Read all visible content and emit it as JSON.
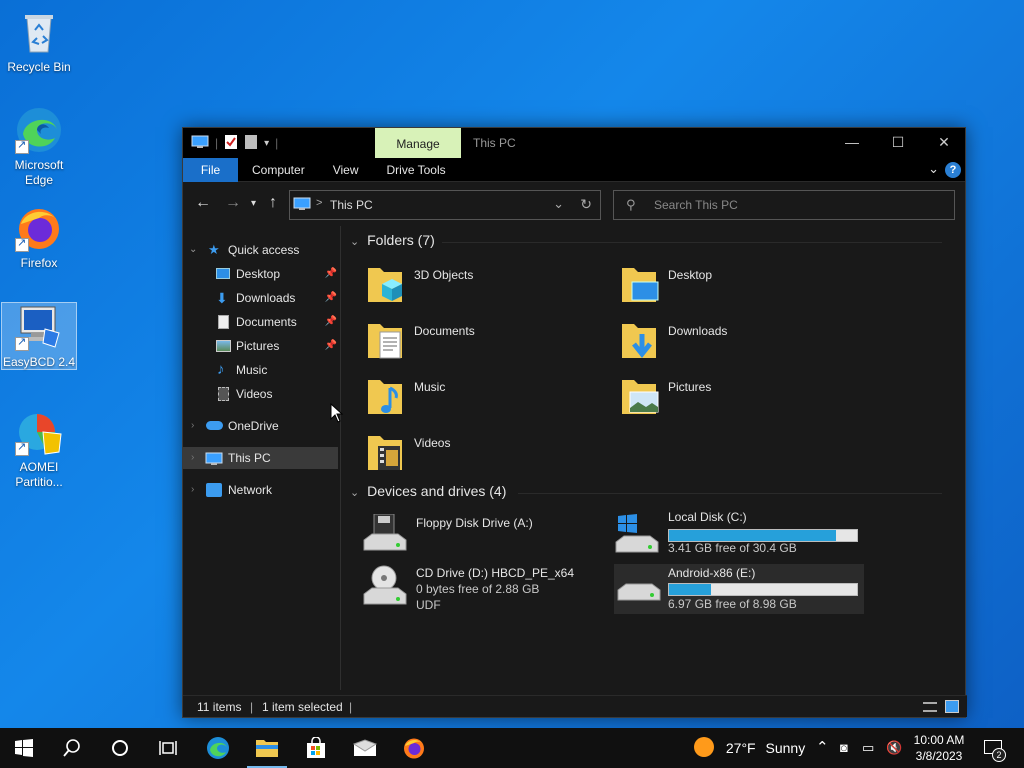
{
  "desktop": {
    "icons": [
      {
        "label": "Recycle Bin"
      },
      {
        "label": "Microsoft Edge"
      },
      {
        "label": "Firefox"
      },
      {
        "label": "EasyBCD 2.4"
      },
      {
        "label": "AOMEI Partitio..."
      }
    ]
  },
  "window": {
    "manage_tab": "Manage",
    "title": "This PC",
    "controls": {
      "minimize": "—",
      "maximize": "☐",
      "close": "✕"
    },
    "ribbon_tabs": [
      "File",
      "Computer",
      "View",
      "Drive Tools"
    ],
    "address": {
      "path": "This PC",
      "separator": ">"
    },
    "search": {
      "placeholder": "Search This PC"
    }
  },
  "nav": {
    "quick_access": "Quick access",
    "quick_items": [
      "Desktop",
      "Downloads",
      "Documents",
      "Pictures",
      "Music",
      "Videos"
    ],
    "onedrive": "OneDrive",
    "this_pc": "This PC",
    "network": "Network"
  },
  "folders": {
    "header": "Folders (7)",
    "items": [
      "3D Objects",
      "Desktop",
      "Documents",
      "Downloads",
      "Music",
      "Pictures",
      "Videos"
    ]
  },
  "drives": {
    "header": "Devices and drives (4)",
    "items": [
      {
        "name": "Floppy Disk Drive (A:)"
      },
      {
        "name": "Local Disk (C:)",
        "free_text": "3.41 GB free of 30.4 GB",
        "used_fraction": 0.888
      },
      {
        "name": "CD Drive (D:) HBCD_PE_x64",
        "line2": "0 bytes free of 2.88 GB",
        "line3": "UDF"
      },
      {
        "name": "Android-x86 (E:)",
        "free_text": "6.97 GB free of 8.98 GB",
        "used_fraction": 0.224
      }
    ]
  },
  "status": {
    "items": "11 items",
    "selected": "1 item selected"
  },
  "taskbar": {
    "weather_temp": "27°F",
    "weather_desc": "Sunny",
    "time": "10:00 AM",
    "date": "3/8/2023",
    "notification_count": "2"
  },
  "colors": {
    "accent": "#1a6fc9",
    "manage_tab": "#d8f2b8",
    "progress": "#26a0da"
  }
}
